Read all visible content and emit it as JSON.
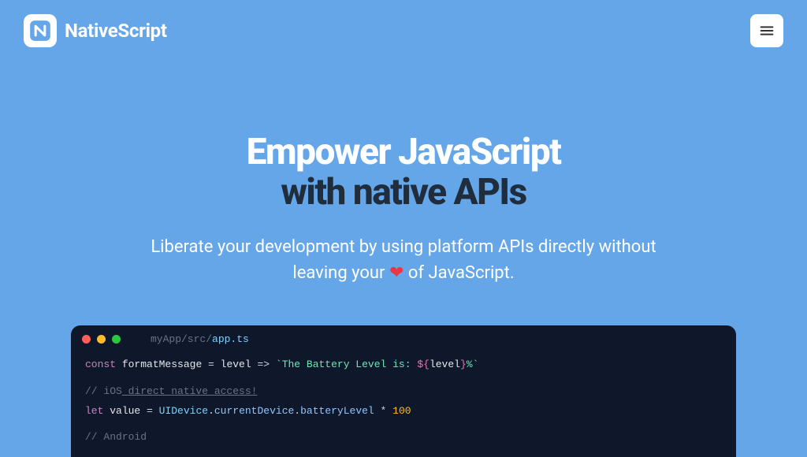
{
  "header": {
    "brand": "NativeScript"
  },
  "hero": {
    "headline_top": "Empower JavaScript",
    "headline_bottom": "with native APIs",
    "sub_before": "Liberate your development by using platform APIs directly without leaving your ",
    "heart": "❤",
    "sub_after": " of JavaScript."
  },
  "code": {
    "path_dim": "myApp/src/",
    "path_file": "app.ts",
    "line1": {
      "kw": "const",
      "name": "formatMessage",
      "eq": " = ",
      "param": "level",
      "arrow": " => ",
      "str_open": "`The Battery Level is: ",
      "interp_open": "${",
      "interp_var": "level",
      "interp_close": "}",
      "str_close": "%`"
    },
    "line2": {
      "slash": "// ",
      "platform": "iOS",
      "rest": " direct native access!"
    },
    "line3": {
      "kw": "let",
      "name": "value",
      "eq": " = ",
      "cls": "UIDevice",
      "dot1": ".",
      "prop1": "currentDevice",
      "dot2": ".",
      "prop2": "batteryLevel",
      "mult": " * ",
      "num": "100"
    },
    "line4": {
      "text": "// Android"
    }
  }
}
